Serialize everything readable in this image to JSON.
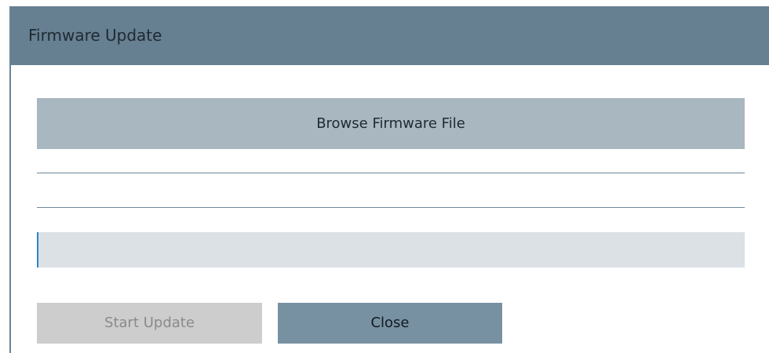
{
  "dialog": {
    "title": "Firmware Update",
    "browse_label": "Browse Firmware File",
    "file_field_value": "",
    "start_update_label": "Start Update",
    "close_label": "Close"
  },
  "colors": {
    "titlebar": "#667f91",
    "browse_button": "#a9b7c1",
    "file_field": "#dbe1e5",
    "start_button_disabled": "#cdcdcd",
    "close_button": "#7891a2"
  }
}
